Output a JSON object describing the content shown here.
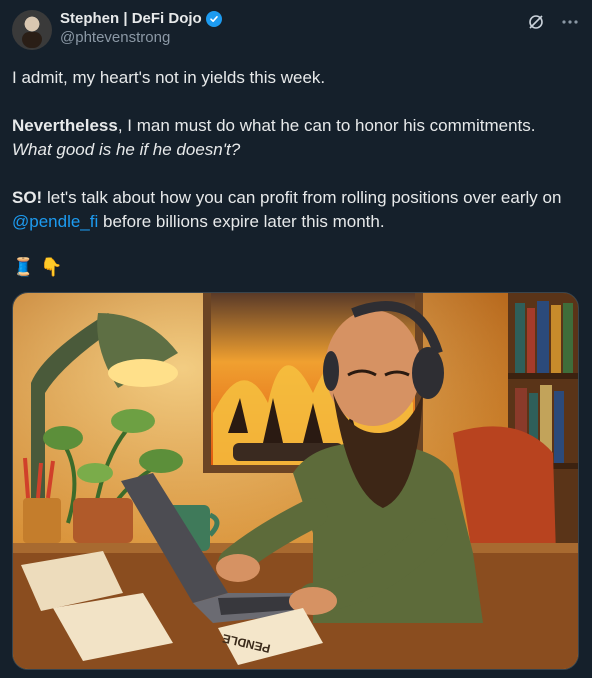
{
  "author": {
    "display_name": "Stephen | DeFi Dojo",
    "handle": "@phtevenstrong",
    "verified": true,
    "accent_color": "#1d9bf0"
  },
  "actions": {
    "grok_icon": "grok-icon",
    "more_icon": "more-icon"
  },
  "tweet": {
    "line1": "I admit, my heart's not in yields this week.",
    "para2_bold": "Nevertheless",
    "para2_rest": ", I man must do what he can to honor his commitments.",
    "para2_italic": "What good is he if he doesn't?",
    "para3_bold": "SO!",
    "para3_rest": " let's talk about how you can profit from rolling positions over early on ",
    "mention": "@pendle_fi",
    "para3_end": " before billions expire later this month.",
    "emoji1": "🧵",
    "emoji2": "👇"
  },
  "media": {
    "paper_label": "PENDLE"
  }
}
